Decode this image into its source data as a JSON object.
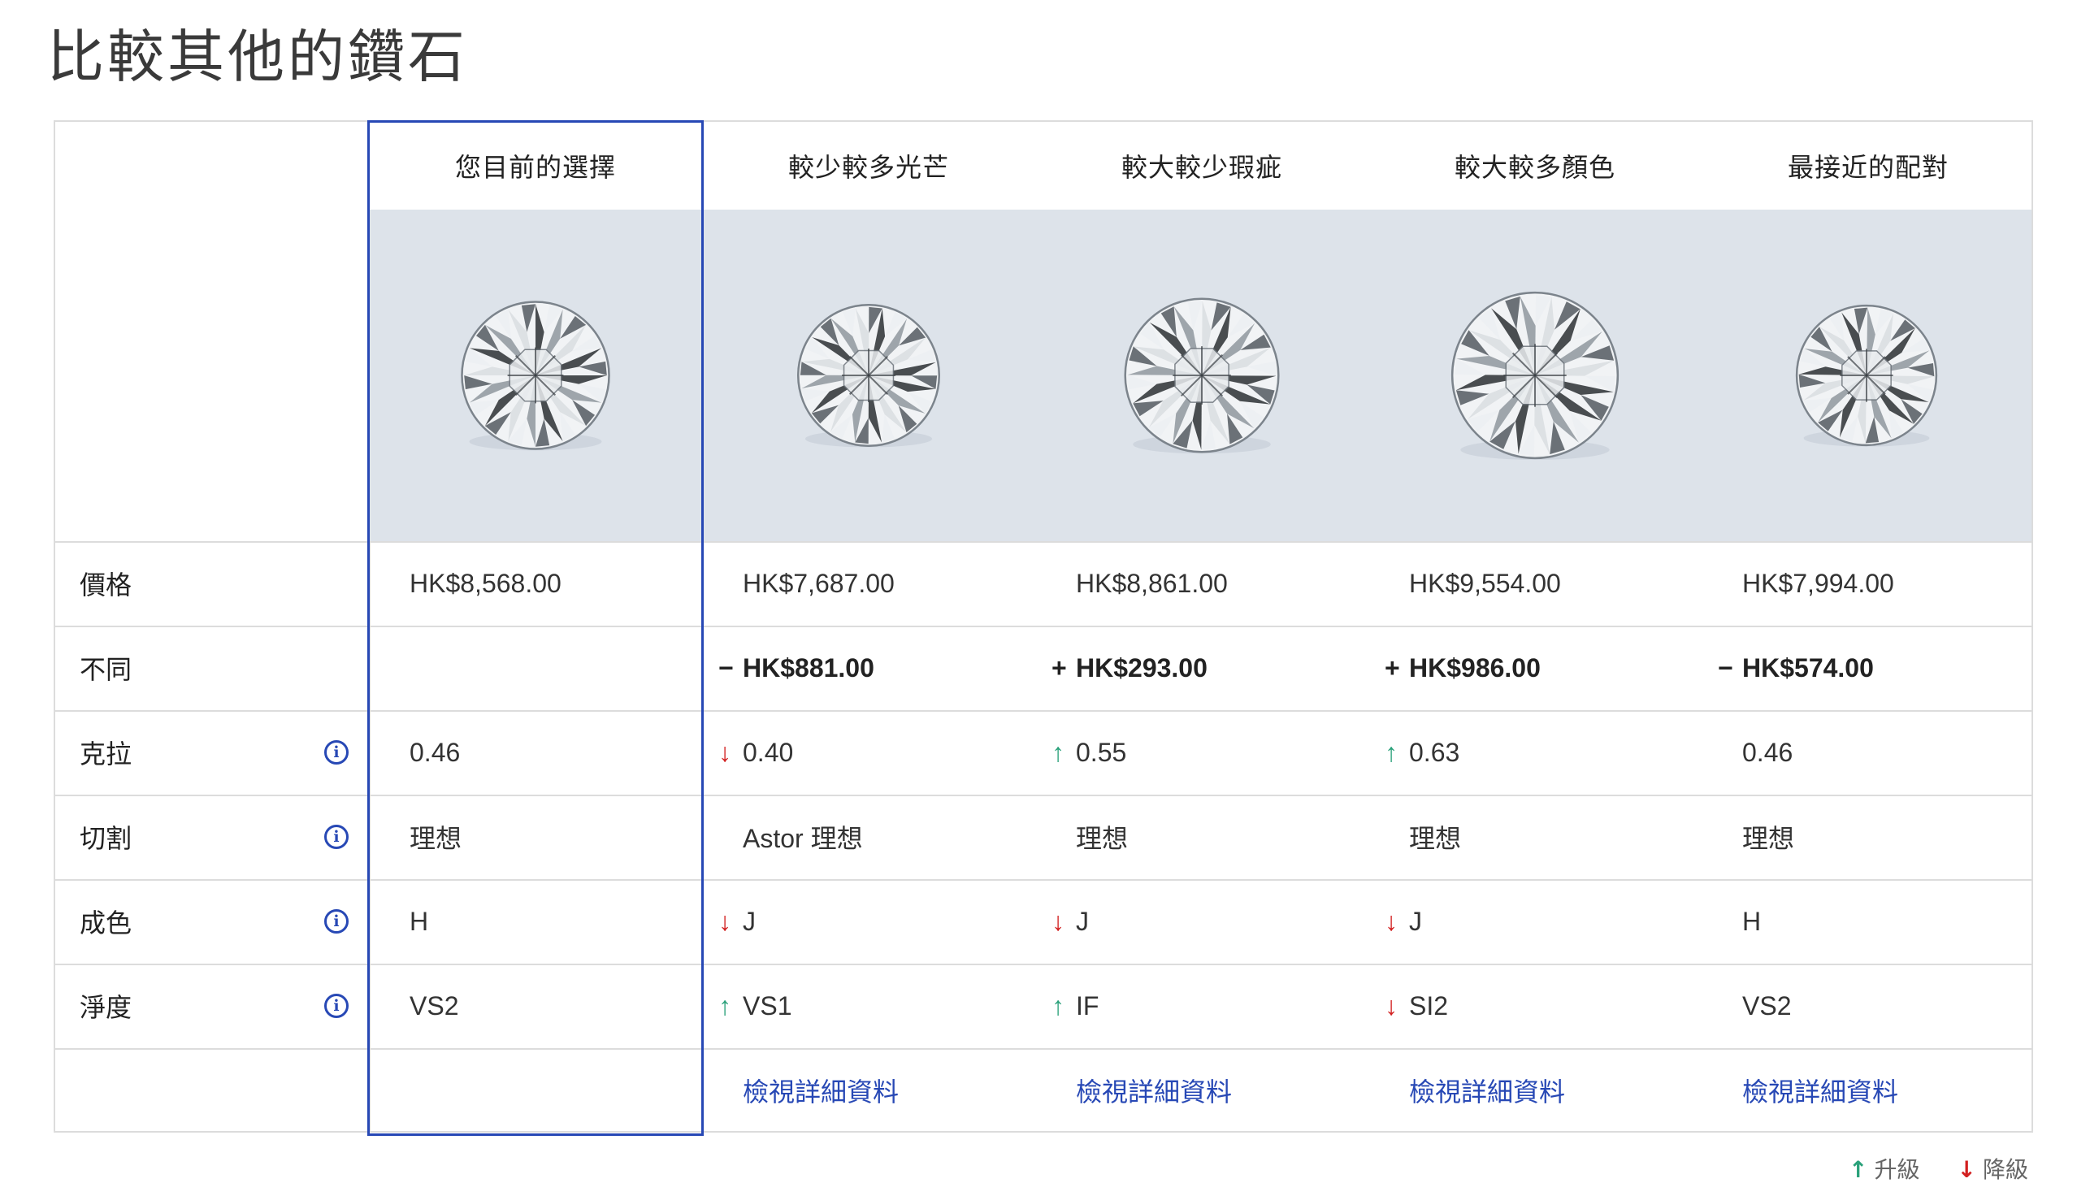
{
  "title": "比較其他的鑽石",
  "columns": [
    {
      "header": "您目前的選擇",
      "price": "HK$8,568.00",
      "diff_sign": "",
      "diff": "",
      "carat_dir": "",
      "carat": "0.46",
      "cut": "理想",
      "color_dir": "",
      "color": "H",
      "clarity_dir": "",
      "clarity": "VS2",
      "link": ""
    },
    {
      "header": "較少較多光芒",
      "price": "HK$7,687.00",
      "diff_sign": "−",
      "diff": "HK$881.00",
      "carat_dir": "down",
      "carat": "0.40",
      "cut": "Astor 理想",
      "color_dir": "down",
      "color": "J",
      "clarity_dir": "up",
      "clarity": "VS1",
      "link": "檢視詳細資料"
    },
    {
      "header": "較大較少瑕疵",
      "price": "HK$8,861.00",
      "diff_sign": "+",
      "diff": "HK$293.00",
      "carat_dir": "up",
      "carat": "0.55",
      "cut": "理想",
      "color_dir": "down",
      "color": "J",
      "clarity_dir": "up",
      "clarity": "IF",
      "link": "檢視詳細資料"
    },
    {
      "header": "較大較多顏色",
      "price": "HK$9,554.00",
      "diff_sign": "+",
      "diff": "HK$986.00",
      "carat_dir": "up",
      "carat": "0.63",
      "cut": "理想",
      "color_dir": "down",
      "color": "J",
      "clarity_dir": "down",
      "clarity": "SI2",
      "link": "檢視詳細資料"
    },
    {
      "header": "最接近的配對",
      "price": "HK$7,994.00",
      "diff_sign": "−",
      "diff": "HK$574.00",
      "carat_dir": "",
      "carat": "0.46",
      "cut": "理想",
      "color_dir": "",
      "color": "H",
      "clarity_dir": "",
      "clarity": "VS2",
      "link": "檢視詳細資料"
    }
  ],
  "rows": [
    {
      "key": "price",
      "label": "價格",
      "info": false
    },
    {
      "key": "diff",
      "label": "不同",
      "info": false
    },
    {
      "key": "carat",
      "label": "克拉",
      "info": true
    },
    {
      "key": "cut",
      "label": "切割",
      "info": true
    },
    {
      "key": "color",
      "label": "成色",
      "info": true
    },
    {
      "key": "clarity",
      "label": "淨度",
      "info": true
    }
  ],
  "legend": {
    "up_arrow": "↑",
    "up_label": "升級",
    "down_arrow": "↓",
    "down_label": "降級"
  },
  "colors": {
    "accent": "#2748b5",
    "up": "#2aa17a",
    "down": "#d22020",
    "image_bg": "#dde3ea"
  }
}
